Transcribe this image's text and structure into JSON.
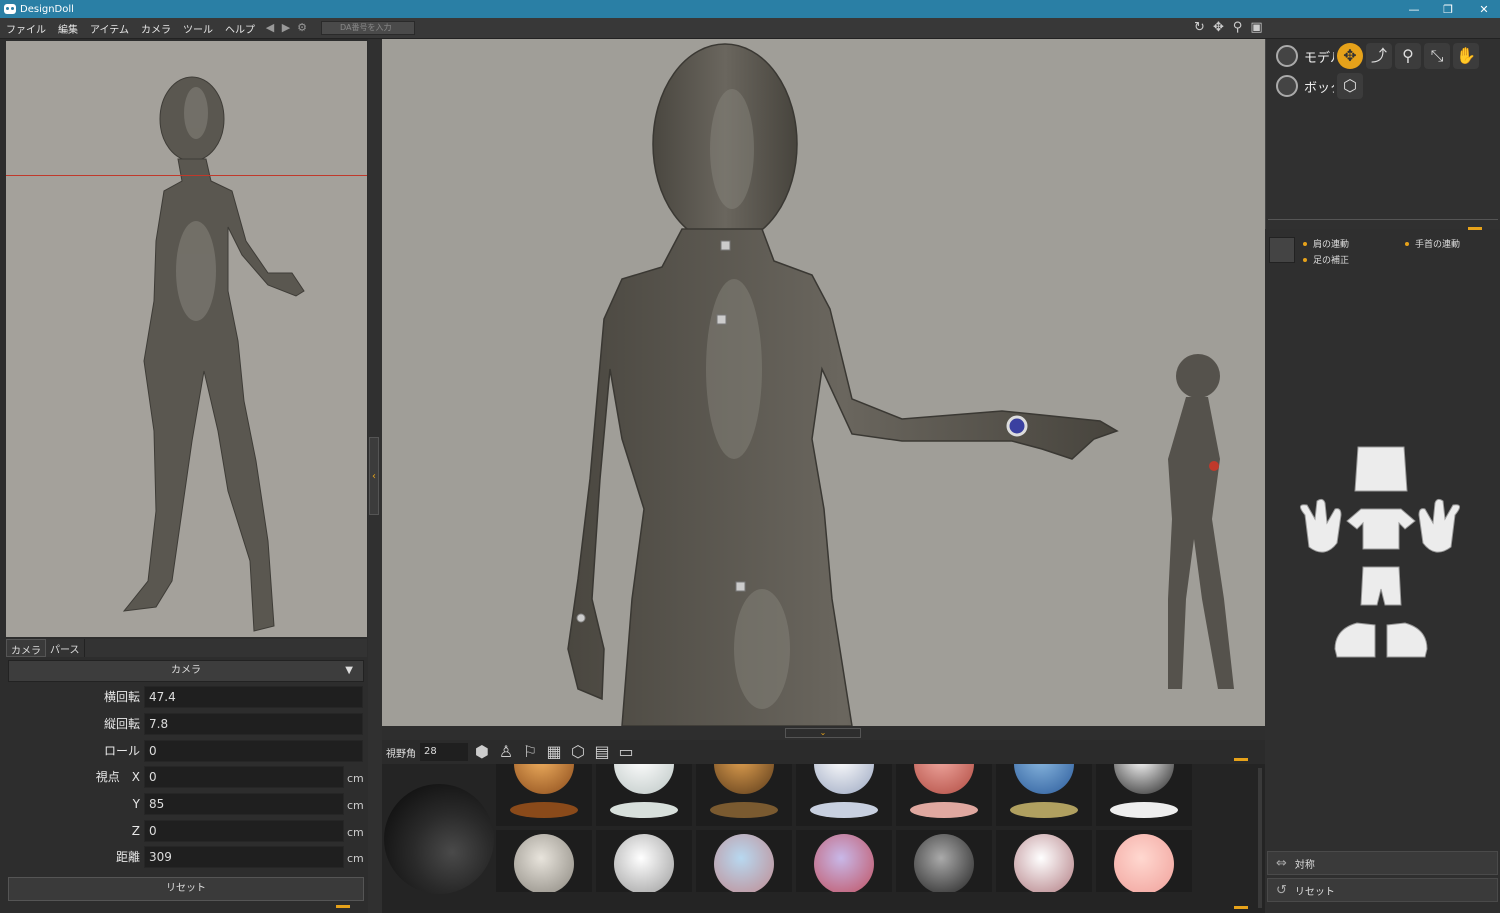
{
  "app": {
    "title": "DesignDoll"
  },
  "window": {
    "minimize": "—",
    "restore": "❐",
    "close": "✕"
  },
  "menu": {
    "items": [
      "ファイル",
      "編集",
      "アイテム",
      "カメラ",
      "ツール",
      "ヘルプ"
    ],
    "da_placeholder": "DA番号を入力"
  },
  "left": {
    "tabs": [
      "カメラ",
      "パース"
    ],
    "header": "カメラ",
    "fields": [
      {
        "label": "横回転",
        "value": "47.4",
        "unit": ""
      },
      {
        "label": "縦回転",
        "value": "7.8",
        "unit": ""
      },
      {
        "label": "ロール",
        "value": "0",
        "unit": ""
      },
      {
        "label": "視点　X",
        "value": "0",
        "unit": "cm"
      },
      {
        "label": "Y",
        "value": "85",
        "unit": "cm"
      },
      {
        "label": "Z",
        "value": "0",
        "unit": "cm"
      },
      {
        "label": "距離",
        "value": "309",
        "unit": "cm"
      }
    ],
    "reset": "リセット"
  },
  "viewport": {
    "fov_label": "視野角",
    "fov_value": "28"
  },
  "right": {
    "rows": [
      {
        "label": "モデル"
      },
      {
        "label": "ボックス"
      }
    ],
    "motion": {
      "shoulder": "肩の連動",
      "wrist": "手首の連動",
      "foot": "足の補正"
    },
    "symmetry": "対称",
    "reset": "リセット"
  },
  "colors": {
    "accent": "#e6a21a",
    "titlebar": "#2a7fa5",
    "viewport_bg": "#a09e98"
  }
}
